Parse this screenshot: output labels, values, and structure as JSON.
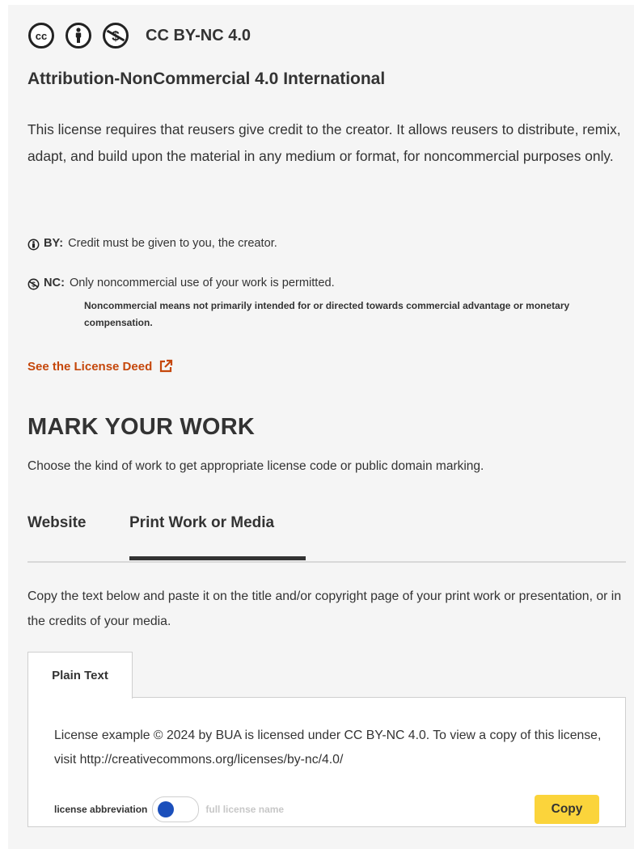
{
  "license": {
    "short_name": "CC BY-NC 4.0",
    "long_name": "Attribution-NonCommercial 4.0 International",
    "icons": [
      "cc-icon",
      "by-attribution-icon",
      "nc-noncommercial-icon"
    ],
    "description": "This license requires that reusers give credit to the creator. It allows reusers to distribute, remix, adapt, and build upon the material in any medium or format, for noncommercial purposes only.",
    "elements": [
      {
        "icon": "by-attribution-icon",
        "code": "BY:",
        "text": "Credit must be given to you, the creator."
      },
      {
        "icon": "nc-noncommercial-icon",
        "code": "NC:",
        "text": "Only noncommercial use of your work is permitted.",
        "subtext": "Noncommercial means not primarily intended for or directed towards commercial advantage or monetary compensation."
      }
    ],
    "deed_link": "See the License Deed",
    "deed_icon": "external-link-icon"
  },
  "mark": {
    "heading": "MARK YOUR WORK",
    "subheading": "Choose the kind of work to get appropriate license code or public domain marking.",
    "tabs": [
      {
        "label": "Website",
        "active": false
      },
      {
        "label": "Print Work or Media",
        "active": true
      }
    ],
    "instructions": "Copy the text below and paste it on the title and/or copyright page of your print work or presentation, or in the credits of your media.",
    "format_tab": "Plain Text",
    "output_text": "License example © 2024 by BUA is licensed under CC BY-NC 4.0. To view a copy of this license, visit http://creativecommons.org/licenses/by-nc/4.0/",
    "toggle": {
      "left_label": "license abbreviation",
      "right_label": "full license name",
      "state": "license abbreviation"
    },
    "copy_button": "Copy"
  },
  "colors": {
    "panel_background": "#f5f5f5",
    "text": "#333333",
    "link": "#c5470b",
    "copy_button": "#fbd43b",
    "toggle_knob": "#1b4fbb"
  }
}
